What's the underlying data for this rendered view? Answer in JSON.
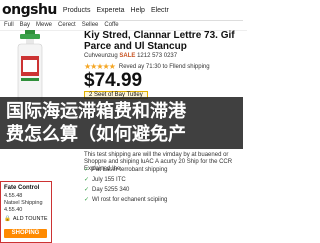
{
  "header": {
    "logo": "ongshu",
    "nav_items": [
      "Products",
      "Expereta",
      "Help",
      "Electr"
    ]
  },
  "categories": [
    "Full",
    "Bay",
    "Mewe",
    "Cerect",
    "Sellee",
    "Coffe"
  ],
  "product": {
    "title": "Kiy Stred, Clannar Lettre 73. Gif Parce and Ul Stancup",
    "ship_prefix": "Cuhveunzug",
    "ship_sale": "SALE",
    "ship_suffix": "1212 573 0237",
    "rating_text": "Reved ay 71:30 to Fllend shipping",
    "price": "$74.99",
    "badge": "2 Seet of Bay Tutley"
  },
  "banner": {
    "line1": "国际海运滞箱费和滞港",
    "line2": "费怎么算（如何避免产"
  },
  "info": {
    "text": "This test shipping are will the vimday by at buaened or Shoppre and shiping luAC A acurty 20 Ship for the CCR Explained Ihe"
  },
  "features": [
    "Pat Laser terrobant shipping",
    "July 155 ITC",
    "Day 5255 340",
    "Wl rost for echanent scipiing"
  ],
  "side_box": {
    "title": "Fate Control",
    "price_1": "4.55.48",
    "shipping_label": "Natsel Shipping",
    "price_2": "4.55.40",
    "stock_label": "ALD TOUNTE",
    "button_label": "SHOPING"
  },
  "colors": {
    "sale": "#c7511f",
    "stars": "#f5a623",
    "check": "#2a9d3a",
    "button": "#ff8a00",
    "sidebox_border": "#cc3333"
  }
}
